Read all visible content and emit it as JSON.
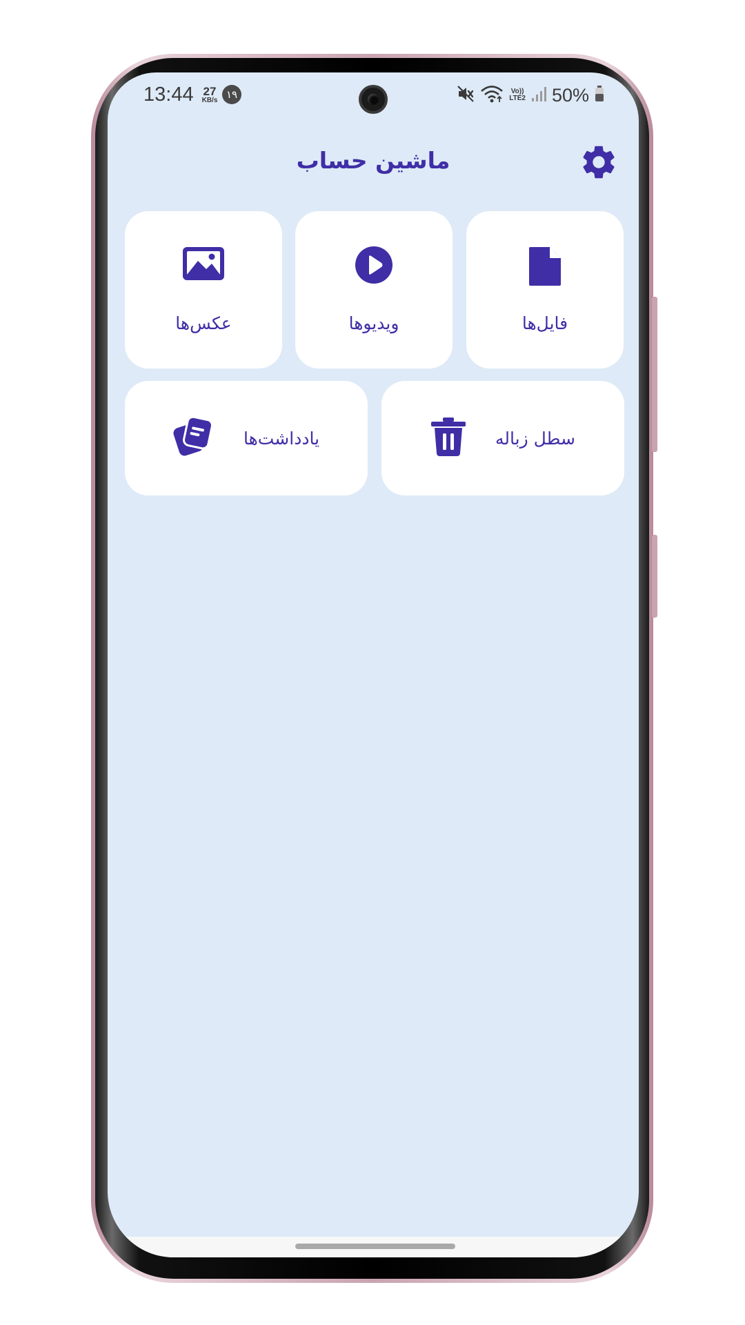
{
  "status_bar": {
    "time": "13:44",
    "speed_value": "27",
    "speed_unit": "KB/s",
    "notification_badge": "۱۹",
    "volte_label_1": "Vo))",
    "volte_label_2": "LTE2",
    "battery_percent": "50%",
    "icons": [
      "mute-icon",
      "wifi-icon",
      "volte-icon",
      "signal-icon",
      "battery-icon"
    ]
  },
  "header": {
    "title": "ماشین حساب",
    "settings_icon": "gear-icon"
  },
  "tiles": [
    {
      "label": "عکس‌ها",
      "icon": "image-icon"
    },
    {
      "label": "ویدیوها",
      "icon": "play-circle-icon"
    },
    {
      "label": "فایل‌ها",
      "icon": "file-icon"
    },
    {
      "label": "یادداشت‌ها",
      "icon": "notes-icon"
    },
    {
      "label": "سطل زباله",
      "icon": "trash-icon"
    }
  ],
  "colors": {
    "accent": "#3f2ea6",
    "background": "#deeaf7",
    "card": "#ffffff"
  }
}
